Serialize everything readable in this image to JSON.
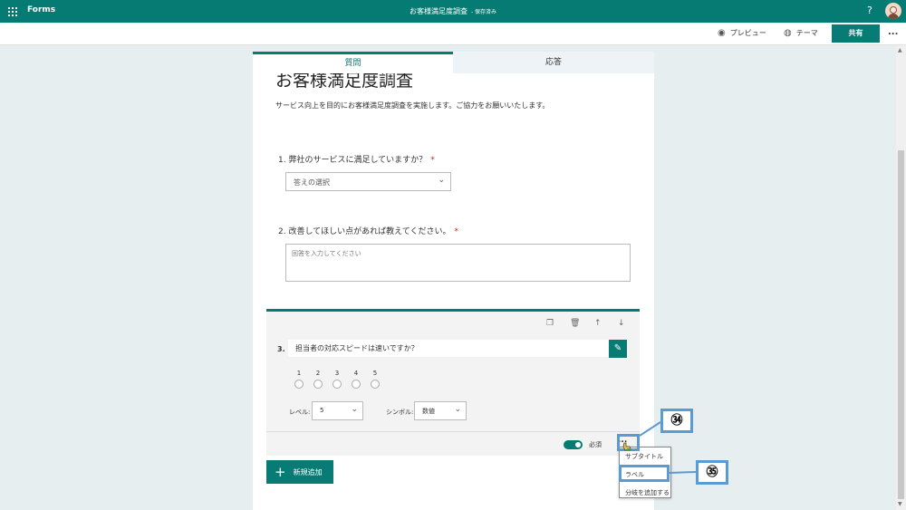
{
  "appbar": {
    "app_name": "Forms",
    "doc_title": "お客様満足度調査",
    "saved_status": "- 保存済み",
    "help": "?"
  },
  "cmdbar": {
    "preview_label": "プレビュー",
    "theme_label": "テーマ",
    "share_label": "共有",
    "more": "..."
  },
  "tabs": [
    {
      "label": "質問"
    },
    {
      "label": "応答"
    }
  ],
  "form": {
    "title": "お客様満足度調査",
    "description": "サービス向上を目的にお客様満足度調査を実施します。ご協力をお願いいたします。"
  },
  "questions": [
    {
      "title": "1. 弊社のサービスに満足していますか？",
      "required_mark": "*",
      "placeholder": "答えの選択"
    },
    {
      "title": "2. 改善してほしい点があれば教えてください。",
      "required_mark": "*",
      "placeholder": "回答を入力してください"
    }
  ],
  "active_question": {
    "number": "3.",
    "title": "担当者の対応スピードは速いですか？",
    "scale": [
      "1",
      "2",
      "3",
      "4",
      "5"
    ],
    "level_label": "レベル:",
    "level_value": "5",
    "symbol_label": "シンボル:",
    "symbol_value": "数値",
    "required_label": "必須",
    "required_on": true,
    "more": "..."
  },
  "add_new_label": "新規追加",
  "menu": {
    "items": [
      {
        "label": "サブタイトル"
      },
      {
        "label": "ラベル"
      },
      {
        "label": "分岐を追加する"
      }
    ]
  },
  "callouts": {
    "c34": "㉞",
    "c35": "㉟"
  },
  "colors": {
    "brand": "#067b74",
    "highlight": "#5b9bd5"
  }
}
